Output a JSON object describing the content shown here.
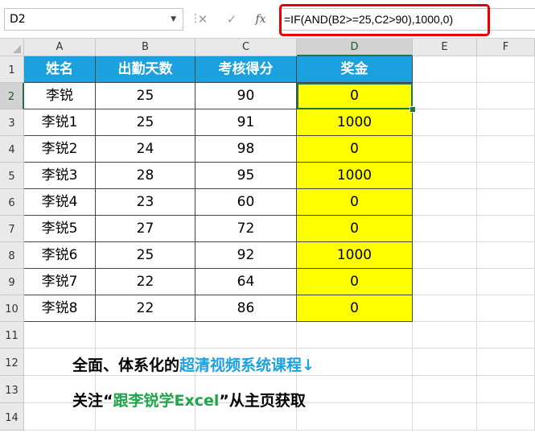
{
  "formula_bar": {
    "name_box": "D2",
    "cancel_icon": "✕",
    "enter_icon": "✓",
    "fx_label": "fx",
    "formula": "=IF(AND(B2>=25,C2>90),1000,0)"
  },
  "columns": [
    "A",
    "B",
    "C",
    "D",
    "E",
    "F"
  ],
  "rows": [
    "1",
    "2",
    "3",
    "4",
    "5",
    "6",
    "7",
    "8",
    "9",
    "10",
    "11",
    "12",
    "13",
    "14"
  ],
  "table": {
    "headers": [
      "姓名",
      "出勤天数",
      "考核得分",
      "奖金"
    ],
    "data": [
      [
        "李锐",
        "25",
        "90",
        "0"
      ],
      [
        "李锐1",
        "25",
        "91",
        "1000"
      ],
      [
        "李锐2",
        "24",
        "98",
        "0"
      ],
      [
        "李锐3",
        "28",
        "95",
        "1000"
      ],
      [
        "李锐4",
        "23",
        "60",
        "0"
      ],
      [
        "李锐5",
        "27",
        "72",
        "0"
      ],
      [
        "李锐6",
        "25",
        "92",
        "1000"
      ],
      [
        "李锐7",
        "22",
        "64",
        "0"
      ],
      [
        "李锐8",
        "22",
        "86",
        "0"
      ]
    ]
  },
  "promo": {
    "line1_part1": "全面、体系化的",
    "line1_part2": "超清视频系统课程↓",
    "line2_part1": "关注“",
    "line2_part2": "跟李锐学Excel",
    "line2_part3": "”从主页获取"
  },
  "colors": {
    "header_fill": "#1ca1e0",
    "bonus_fill": "#ffff00",
    "highlight_border": "#e60000",
    "selection": "#217346"
  }
}
